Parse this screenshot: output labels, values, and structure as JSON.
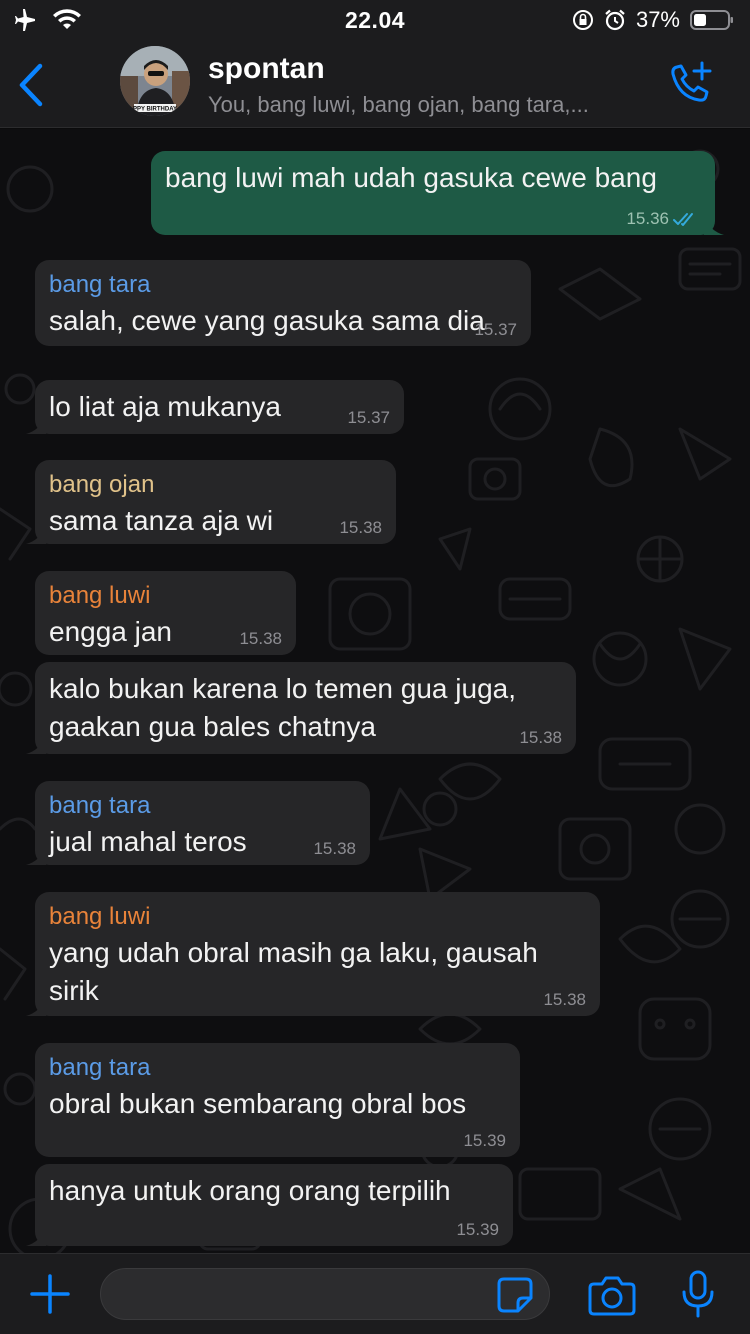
{
  "status_bar": {
    "time": "22.04",
    "battery": "37%"
  },
  "header": {
    "title": "spontan",
    "subtitle": "You, bang luwi, bang ojan, bang tara,...",
    "avatar_caption": "PPY BIRTHDAY"
  },
  "colors": {
    "accent": "#0a84ff",
    "bubble_out": "#1e5a45",
    "bubble_in": "#262628",
    "sender_tara": "#5b9be6",
    "sender_ojan": "#e0c28a",
    "sender_luwi": "#e8833a"
  },
  "messages": [
    {
      "direction": "out",
      "text": "bang luwi mah udah gasuka cewe bang",
      "time": "15.36",
      "status": "read"
    },
    {
      "direction": "in",
      "sender": "bang tara",
      "text": "salah, cewe yang gasuka sama dia",
      "time": "15.37"
    },
    {
      "direction": "in",
      "text": "lo liat aja mukanya",
      "time": "15.37"
    },
    {
      "direction": "in",
      "sender": "bang ojan",
      "text": "sama tanza aja wi",
      "time": "15.38"
    },
    {
      "direction": "in",
      "sender": "bang luwi",
      "text": "engga jan",
      "time": "15.38"
    },
    {
      "direction": "in",
      "text": "kalo bukan karena lo temen gua juga, gaakan gua bales chatnya",
      "time": "15.38"
    },
    {
      "direction": "in",
      "sender": "bang tara",
      "text": "jual mahal teros",
      "time": "15.38"
    },
    {
      "direction": "in",
      "sender": "bang luwi",
      "text": "yang udah obral masih ga laku, gausah sirik",
      "time": "15.38"
    },
    {
      "direction": "in",
      "sender": "bang tara",
      "text": "obral bukan sembarang obral bos",
      "time": "15.39"
    },
    {
      "direction": "in",
      "text": "hanya untuk orang orang terpilih",
      "time": "15.39"
    }
  ],
  "input": {
    "value": "",
    "placeholder": ""
  },
  "icons": {
    "airplane": "airplane-icon",
    "wifi": "wifi-icon",
    "rotation_lock": "rotation-lock-icon",
    "alarm": "alarm-icon",
    "battery": "battery-icon",
    "back": "chevron-left-icon",
    "call": "add-call-icon",
    "plus": "plus-icon",
    "sticker": "sticker-icon",
    "camera": "camera-icon",
    "mic": "microphone-icon"
  }
}
